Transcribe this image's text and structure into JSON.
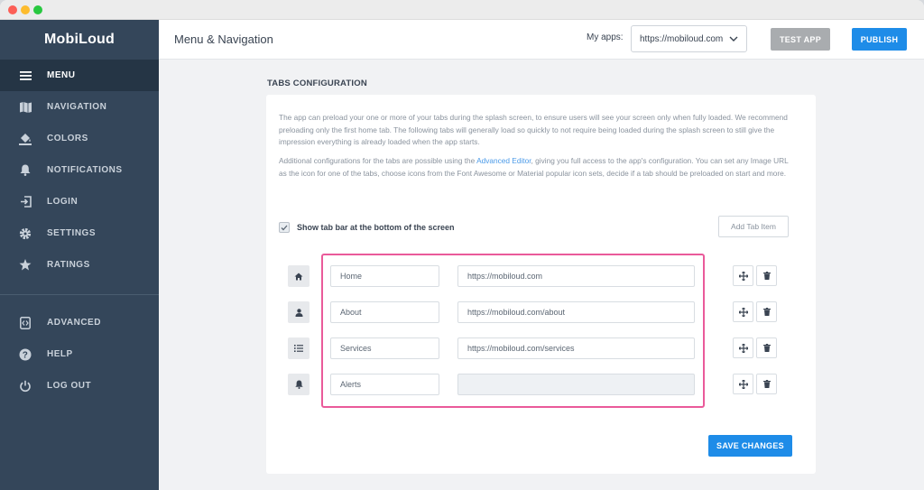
{
  "app": {
    "name": "MobiLoud"
  },
  "sidebar": {
    "items": [
      {
        "label": "MENU",
        "icon": "hamburger-icon"
      },
      {
        "label": "NAVIGATION",
        "icon": "map-icon"
      },
      {
        "label": "COLORS",
        "icon": "paint-bucket-icon"
      },
      {
        "label": "NOTIFICATIONS",
        "icon": "bell-icon"
      },
      {
        "label": "LOGIN",
        "icon": "sign-in-icon"
      },
      {
        "label": "SETTINGS",
        "icon": "gear-icon"
      },
      {
        "label": "RATINGS",
        "icon": "star-icon"
      },
      {
        "label": "ADVANCED",
        "icon": "code-icon"
      },
      {
        "label": "HELP",
        "icon": "question-icon"
      },
      {
        "label": "LOG OUT",
        "icon": "power-icon"
      }
    ]
  },
  "header": {
    "title": "Menu & Navigation",
    "my_apps_label": "My apps:",
    "selected_app": "https://mobiloud.com",
    "test_app_label": "TEST APP",
    "publish_label": "PUBLISH"
  },
  "tabs_config": {
    "section_title": "TABS CONFIGURATION",
    "para1": "The app can preload your one or more of your tabs during the splash screen, to ensure users will see your screen only when fully loaded. We recommend preloading only the first home tab. The following tabs will generally load so quickly to not require being loaded during the splash screen to still give the impression everything is already loaded when the app starts.",
    "para2_before": "Additional configurations for the tabs are possible using the ",
    "para2_link": "Advanced Editor",
    "para2_after": ", giving you full access to the app's configuration. You can set any Image URL as the icon for one of the tabs, choose icons from the Font Awesome or Material popular icon sets, decide if a tab should be preloaded on start and more.",
    "show_tab_bar_label": "Show tab bar at the bottom of the screen",
    "show_tab_bar_checked": true,
    "add_tab_label": "Add Tab Item",
    "tabs": [
      {
        "icon": "home-icon",
        "name": "Home",
        "url": "https://mobiloud.com"
      },
      {
        "icon": "user-icon",
        "name": "About",
        "url": "https://mobiloud.com/about"
      },
      {
        "icon": "list-icon",
        "name": "Services",
        "url": "https://mobiloud.com/services"
      },
      {
        "icon": "bell-icon",
        "name": "Alerts",
        "url": ""
      }
    ],
    "save_label": "SAVE CHANGES"
  },
  "colors": {
    "sidebar_bg": "#34465a",
    "sidebar_active_bg": "#253545",
    "primary_blue": "#1e8ce8",
    "highlight_pink": "#ea5a9a",
    "test_app_gray": "#a9acaf"
  }
}
